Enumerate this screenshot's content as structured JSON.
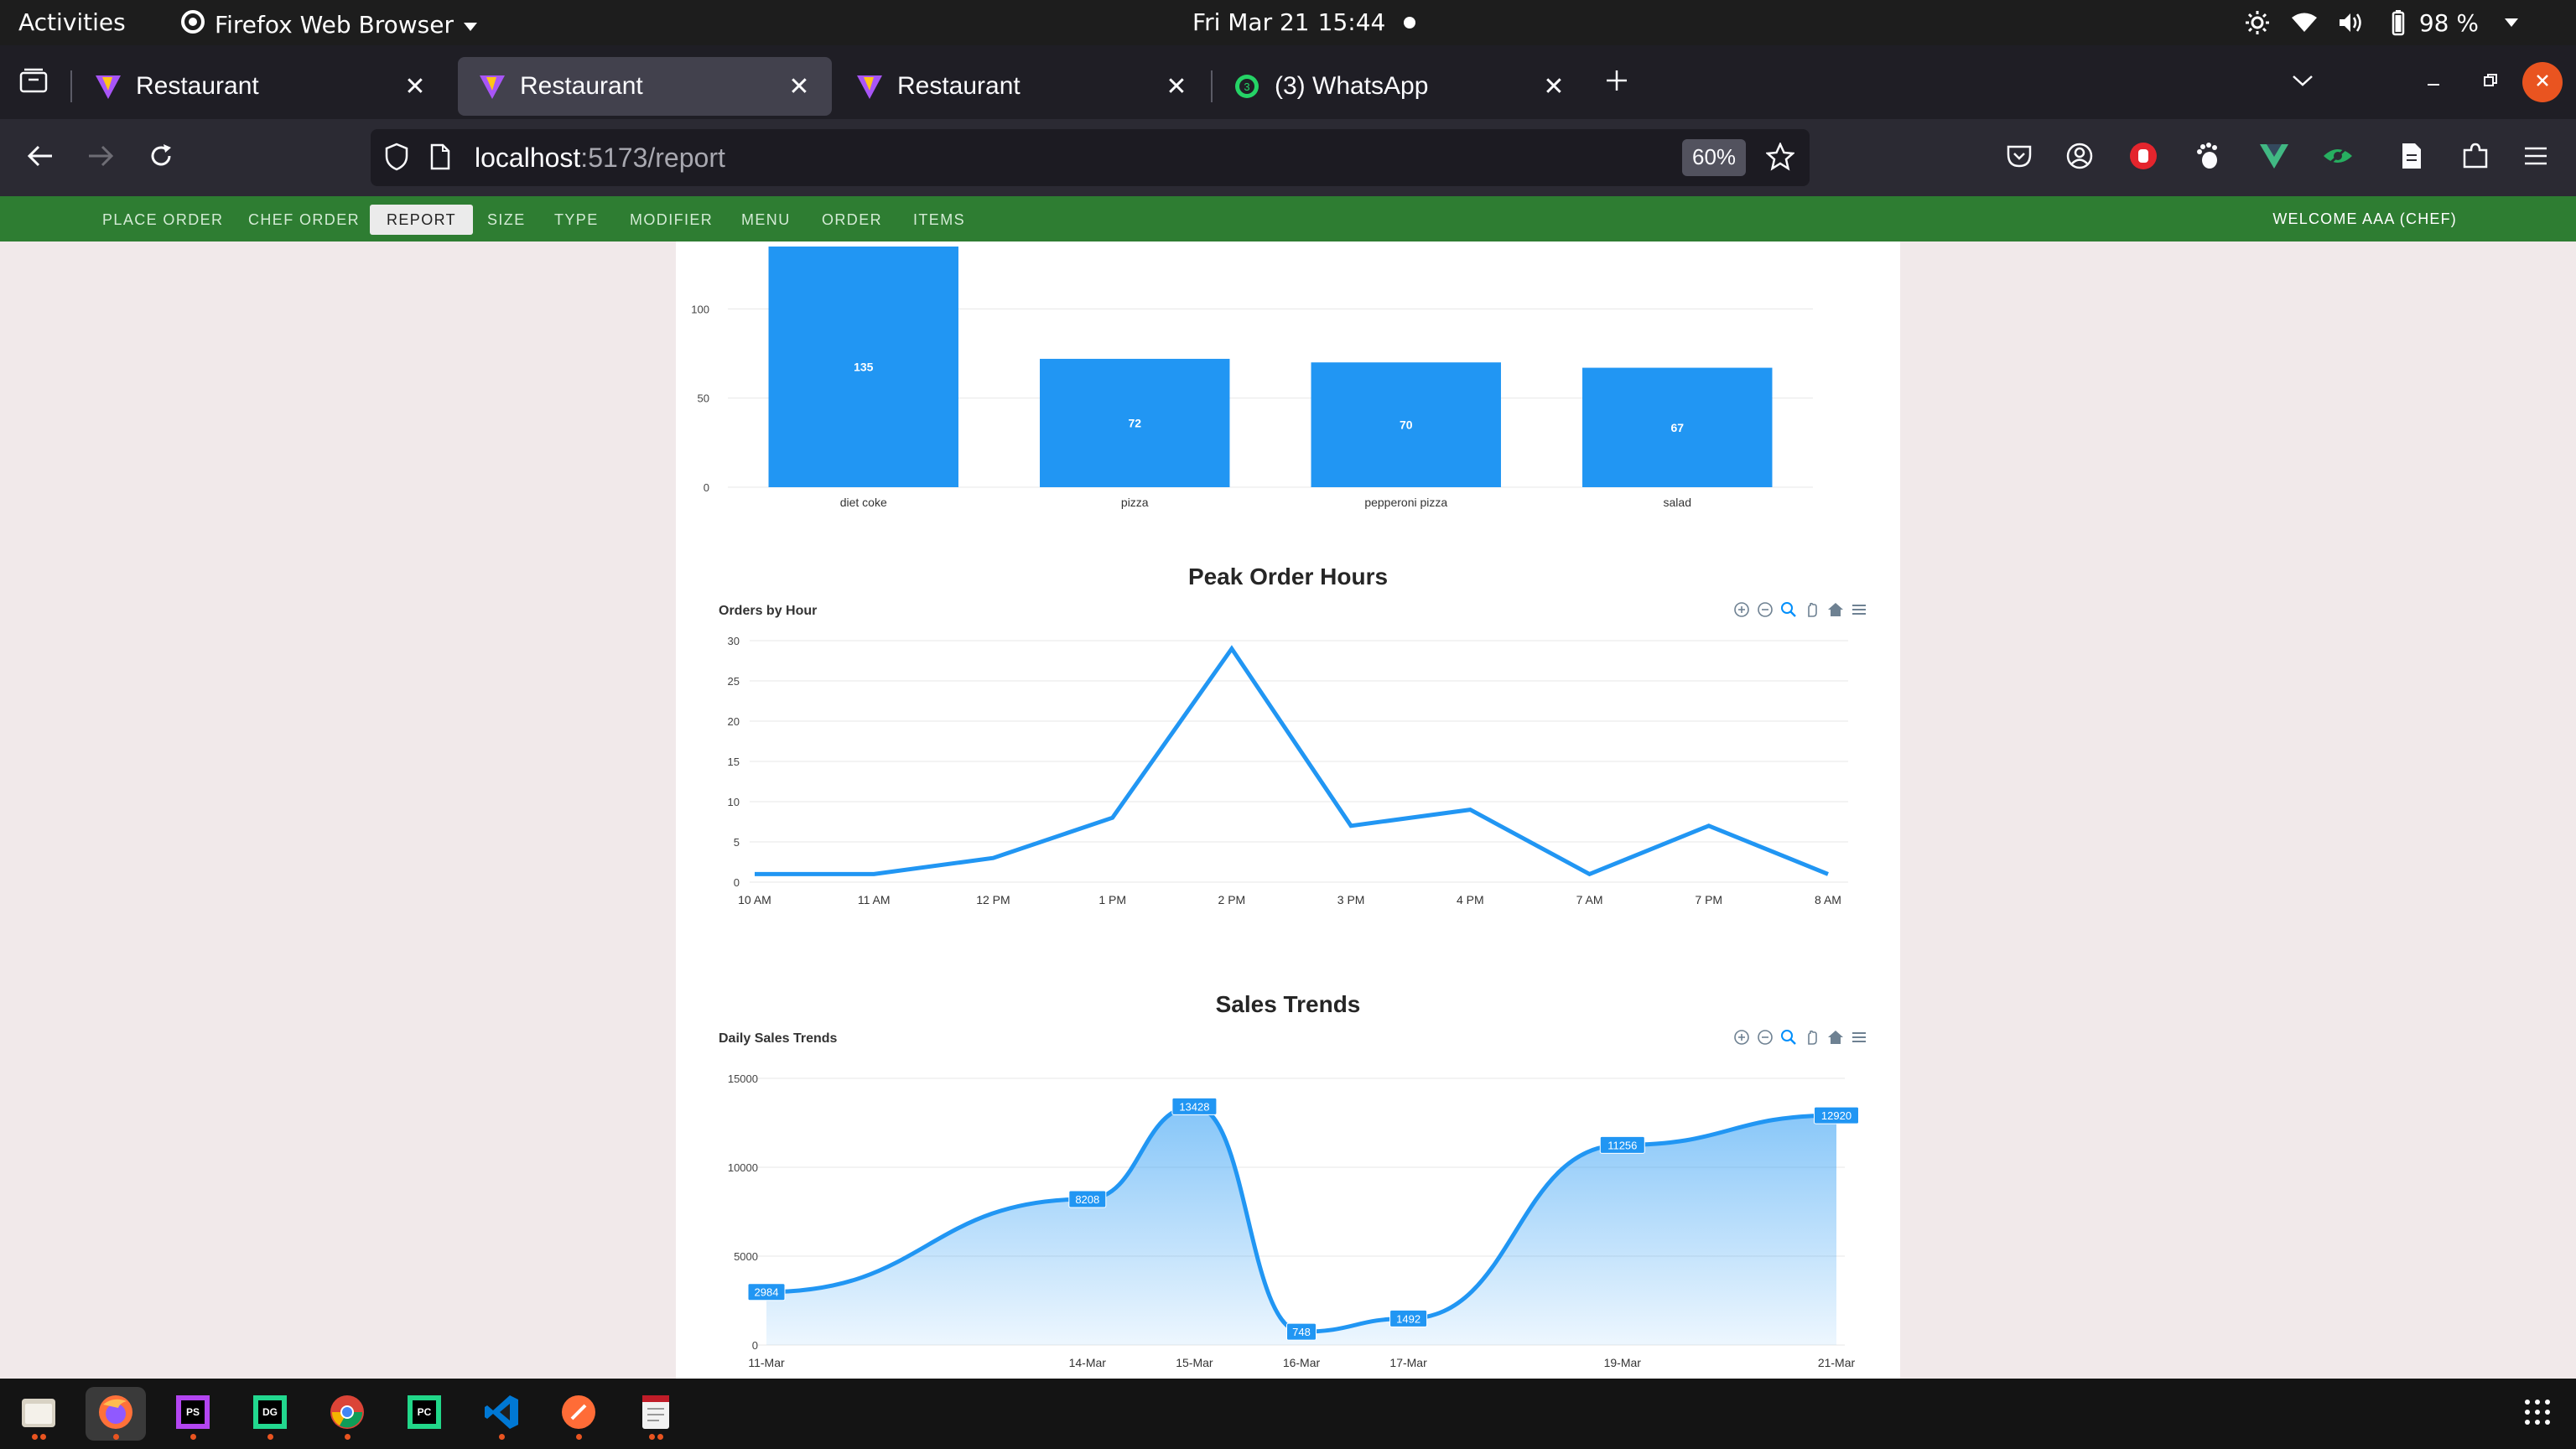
{
  "topbar": {
    "activities": "Activities",
    "app_name": "Firefox Web Browser",
    "date": "Fri Mar 21",
    "time": "15:44",
    "battery": "98 %"
  },
  "tabs": [
    {
      "label": "Restaurant",
      "active": false
    },
    {
      "label": "Restaurant",
      "active": true
    },
    {
      "label": "Restaurant",
      "active": false
    },
    {
      "label": "(3) WhatsApp",
      "active": false,
      "badge": "3"
    }
  ],
  "urlbar": {
    "host": "localhost",
    "path": ":5173/report",
    "zoom": "60%"
  },
  "appnav": {
    "items": [
      "PLACE ORDER",
      "CHEF ORDER",
      "REPORT",
      "SIZE",
      "TYPE",
      "MODIFIER",
      "MENU",
      "ORDER",
      "ITEMS"
    ],
    "active": "REPORT",
    "welcome": "WELCOME AAA (CHEF)"
  },
  "colors": {
    "accent_green": "#2e7d32",
    "series_blue": "#2196f3",
    "line_blue": "#2196f3"
  },
  "chart_data": [
    {
      "type": "bar",
      "title": "",
      "categories": [
        "diet coke",
        "pizza",
        "pepperoni pizza",
        "salad"
      ],
      "values": [
        135,
        72,
        70,
        67
      ],
      "data_labels": [
        "135",
        "72",
        "70",
        "67"
      ],
      "y_ticks": [
        "0",
        "50",
        "100"
      ],
      "ylim": [
        0,
        135
      ],
      "grid": true
    },
    {
      "type": "line",
      "title": "Peak Order Hours",
      "subtitle": "Orders by Hour",
      "categories": [
        "10 AM",
        "11 AM",
        "12 PM",
        "1 PM",
        "2 PM",
        "3 PM",
        "4 PM",
        "7 AM",
        "7 PM",
        "8 AM"
      ],
      "values": [
        1,
        1,
        3,
        8,
        29,
        7,
        9,
        1,
        7,
        1
      ],
      "y_ticks": [
        "0",
        "5",
        "10",
        "15",
        "20",
        "25",
        "30"
      ],
      "ylim": [
        0,
        30
      ],
      "grid": true
    },
    {
      "type": "area",
      "title": "Sales Trends",
      "subtitle": "Daily Sales Trends",
      "x": [
        "2025-03-11",
        "2025-03-14",
        "2025-03-15",
        "2025-03-16",
        "2025-03-17",
        "2025-03-19",
        "2025-03-21"
      ],
      "x_tick_labels": [
        "11-Mar",
        "14-Mar",
        "15-Mar",
        "16-Mar",
        "17-Mar",
        "19-Mar",
        "21-Mar"
      ],
      "values": [
        2984,
        8208,
        13428,
        748,
        1492,
        11256,
        12920
      ],
      "data_labels": [
        "2984",
        "8208",
        "13428",
        "748",
        "1492",
        "11256",
        "12920"
      ],
      "y_ticks": [
        "0",
        "5000",
        "10000",
        "15000"
      ],
      "ylim": [
        0,
        15000
      ],
      "grid": true
    }
  ]
}
